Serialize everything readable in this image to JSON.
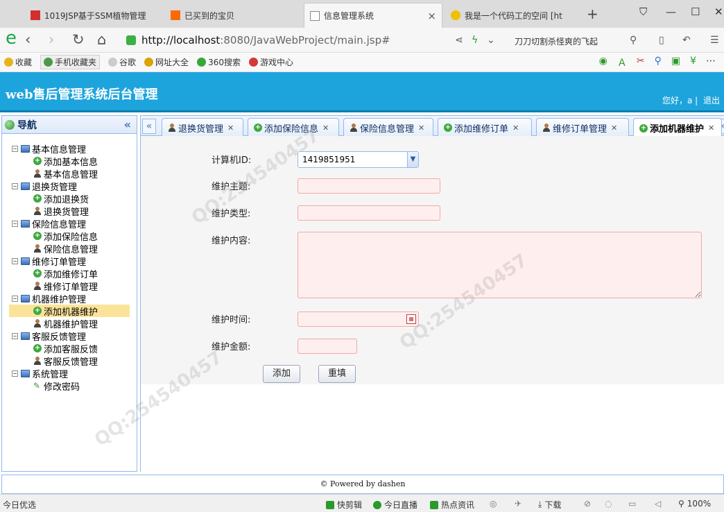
{
  "browser": {
    "tabs": [
      {
        "title": "1019JSP基于SSM植物管理"
      },
      {
        "title": "已买到的宝贝"
      },
      {
        "title": "信息管理系统"
      },
      {
        "title": "我是一个代码工的空间 [ht"
      }
    ],
    "url_host": "http://localhost",
    "url_rest": ":8080/JavaWebProject/main.jsp#",
    "search_hint": "刀刀切割杀怪爽的飞起"
  },
  "bookmarks": [
    {
      "label": "收藏",
      "color": "#e8b21e"
    },
    {
      "label": "手机收藏夹",
      "color": "#4a9a4a"
    },
    {
      "label": "谷歌",
      "color": "#cccccc"
    },
    {
      "label": "网址大全",
      "color": "#d9a400"
    },
    {
      "label": "360搜索",
      "color": "#3aa63a"
    },
    {
      "label": "游戏中心",
      "color": "#d13a3a"
    }
  ],
  "app": {
    "title": "web售后管理系统后台管理",
    "greeting": "您好，a",
    "logout": "退出"
  },
  "sidebar": {
    "title": "导航",
    "tree": [
      {
        "label": "基本信息管理",
        "children": [
          {
            "label": "添加基本信息",
            "icon": "add"
          },
          {
            "label": "基本信息管理",
            "icon": "user"
          }
        ]
      },
      {
        "label": "退换货管理",
        "children": [
          {
            "label": "添加退换货",
            "icon": "add"
          },
          {
            "label": "退换货管理",
            "icon": "user"
          }
        ]
      },
      {
        "label": "保险信息管理",
        "children": [
          {
            "label": "添加保险信息",
            "icon": "add"
          },
          {
            "label": "保险信息管理",
            "icon": "user"
          }
        ]
      },
      {
        "label": "维修订单管理",
        "children": [
          {
            "label": "添加维修订单",
            "icon": "add"
          },
          {
            "label": "维修订单管理",
            "icon": "user"
          }
        ]
      },
      {
        "label": "机器维护管理",
        "children": [
          {
            "label": "添加机器维护",
            "icon": "add",
            "selected": true
          },
          {
            "label": "机器维护管理",
            "icon": "user"
          }
        ]
      },
      {
        "label": "客服反馈管理",
        "children": [
          {
            "label": "添加客服反馈",
            "icon": "add"
          },
          {
            "label": "客服反馈管理",
            "icon": "user"
          }
        ]
      },
      {
        "label": "系统管理",
        "children": [
          {
            "label": "修改密码",
            "icon": "pen"
          }
        ]
      }
    ]
  },
  "tabs": [
    {
      "label": "退换货管理",
      "icon": "user"
    },
    {
      "label": "添加保险信息",
      "icon": "add"
    },
    {
      "label": "保险信息管理",
      "icon": "user"
    },
    {
      "label": "添加维修订单",
      "icon": "add"
    },
    {
      "label": "维修订单管理",
      "icon": "user"
    },
    {
      "label": "添加机器维护",
      "icon": "add",
      "active": true
    }
  ],
  "form": {
    "computer_id_label": "计算机ID:",
    "computer_id_value": "1419851951",
    "subject_label": "维护主题:",
    "type_label": "维护类型:",
    "content_label": "维护内容:",
    "time_label": "维护时间:",
    "amount_label": "维护金额:",
    "add_button": "添加",
    "reset_button": "重填"
  },
  "footer": {
    "text": "© Powered by dashen"
  },
  "statusbar": {
    "left": "今日优选",
    "items": [
      "快剪辑",
      "今日直播",
      "热点资讯",
      "下载"
    ],
    "zoom": "100%"
  }
}
